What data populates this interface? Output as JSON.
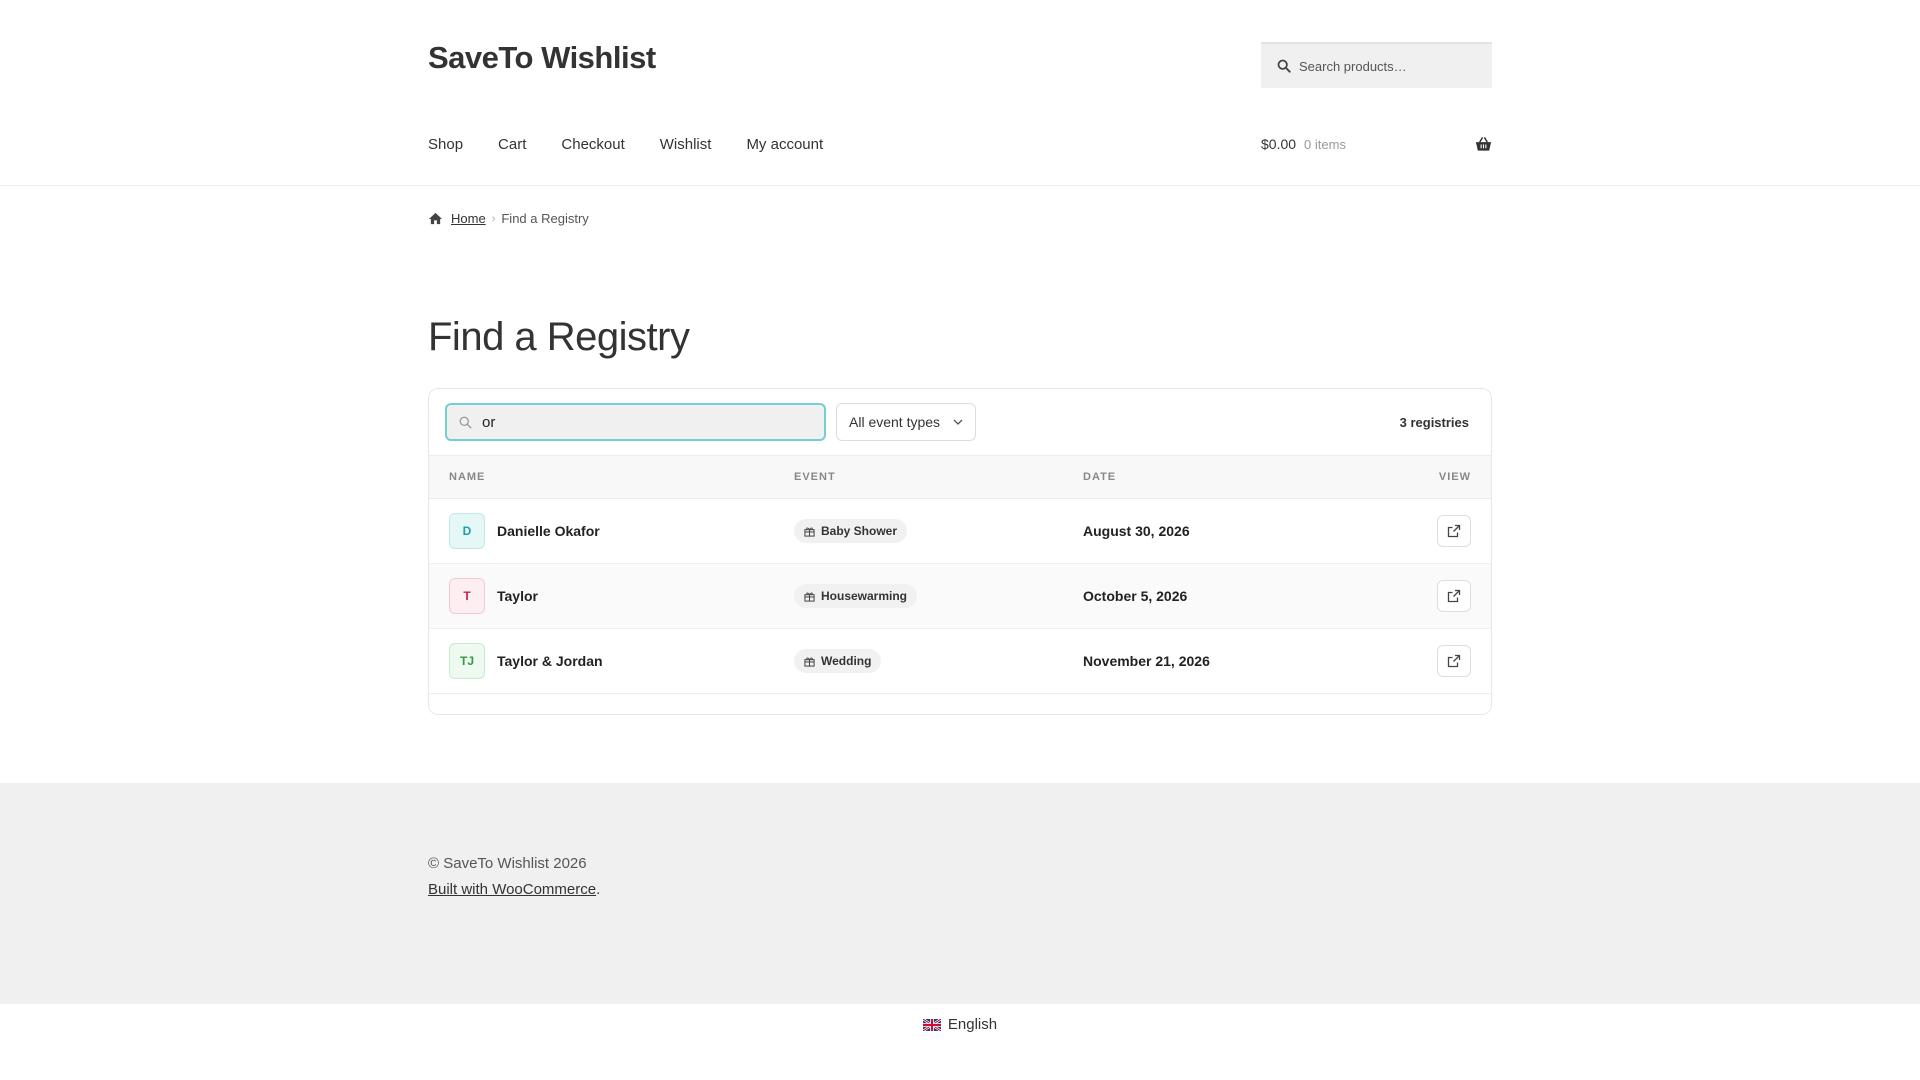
{
  "site": {
    "title": "SaveTo Wishlist"
  },
  "header_search": {
    "placeholder": "Search products…"
  },
  "nav": {
    "items": [
      "Shop",
      "Cart",
      "Checkout",
      "Wishlist",
      "My account"
    ]
  },
  "cart": {
    "amount": "$0.00",
    "count": "0 items"
  },
  "breadcrumb": {
    "home": "Home",
    "current": "Find a Registry"
  },
  "page": {
    "title": "Find a Registry"
  },
  "registry": {
    "search_value": "or",
    "event_filter": "All event types",
    "count_label": "3 registries",
    "columns": {
      "name": "NAME",
      "event": "EVENT",
      "date": "DATE",
      "view": "VIEW"
    },
    "rows": [
      {
        "initials": "D",
        "name": "Danielle Okafor",
        "event": "Baby Shower",
        "date": "August 30, 2026",
        "avatar_bg": "#e6f7f8",
        "avatar_fg": "#1f9ea3",
        "avatar_border": "#bfe8ea"
      },
      {
        "initials": "T",
        "name": "Taylor",
        "event": "Housewarming",
        "date": "October 5, 2026",
        "avatar_bg": "#fdeef1",
        "avatar_fg": "#c2284d",
        "avatar_border": "#f4c9d3"
      },
      {
        "initials": "TJ",
        "name": "Taylor & Jordan",
        "event": "Wedding",
        "date": "November 21, 2026",
        "avatar_bg": "#eefaf0",
        "avatar_fg": "#2e9b45",
        "avatar_border": "#c6ebcd"
      }
    ]
  },
  "footer": {
    "copyright": "© SaveTo Wishlist 2026",
    "built_with_link": "Built with WooCommerce",
    "built_with_suffix": "."
  },
  "language": {
    "label": "English"
  },
  "colors": {
    "accent_focus": "#74cfd0"
  }
}
